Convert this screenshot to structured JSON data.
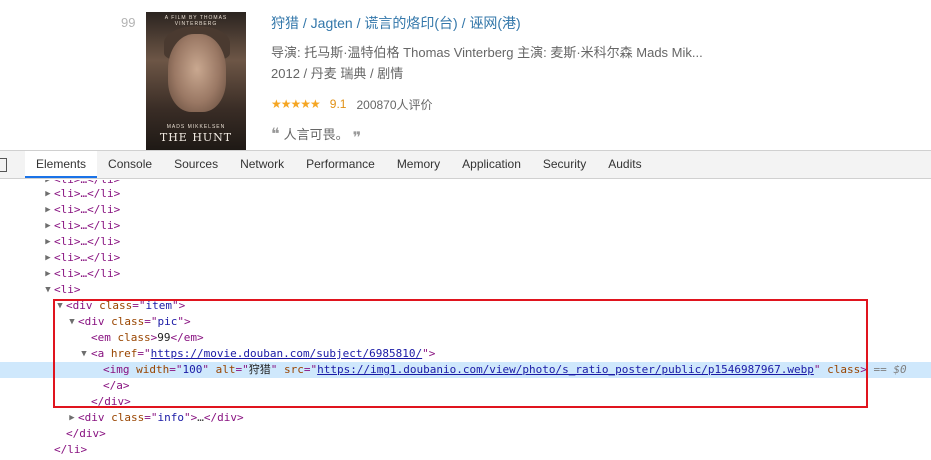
{
  "movie": {
    "rank": "99",
    "poster": {
      "top_credit": "A FILM BY THOMAS VINTERBERG",
      "actor": "MADS MIKKELSEN",
      "title": "THE HUNT"
    },
    "title_main": "狩猎",
    "title_parts": [
      "/ Jagten",
      "/ 谎言的烙印(台) / 诬网(港)"
    ],
    "credits": "导演: 托马斯·温特伯格 Thomas Vinterberg   主演: 麦斯·米科尔森 Mads Mik...",
    "year_country_genre": "2012 / 丹麦 瑞典 / 剧情",
    "stars": "★★★★★",
    "score": "9.1",
    "votes": "200870人评价",
    "quote_open": "❝",
    "quote": "人言可畏。",
    "quote_close": "❞"
  },
  "devtools": {
    "tabs": [
      "Elements",
      "Console",
      "Sources",
      "Network",
      "Performance",
      "Memory",
      "Application",
      "Security",
      "Audits"
    ],
    "active_tab": "Elements",
    "dom": {
      "li_collapsed": "<li>…</li>",
      "li_open": "<li>",
      "div_item_open": [
        "<div ",
        "class",
        "=\"",
        "item",
        "\">"
      ],
      "div_pic_open": [
        "<div ",
        "class",
        "=\"",
        "pic",
        "\">"
      ],
      "em": [
        "<em ",
        "class",
        ">",
        "99",
        "</em>"
      ],
      "a_open": [
        "<a ",
        "href",
        "=\"",
        "https://movie.douban.com/subject/6985810/",
        "\">"
      ],
      "img": {
        "width_attr": "width",
        "width_val": "100",
        "alt_attr": "alt",
        "alt_val": "狩猎",
        "src_attr": "src",
        "src_val": "https://img1.doubanio.com/view/photo/s_ratio_poster/public/p1546987967.webp",
        "class_attr": "class",
        "eq": "== $0"
      },
      "a_close": "</a>",
      "div_close": "</div>",
      "div_info": [
        "<div ",
        "class",
        "=\"",
        "info",
        "\">",
        "…",
        "</div>"
      ],
      "li_close": "</li>"
    }
  }
}
